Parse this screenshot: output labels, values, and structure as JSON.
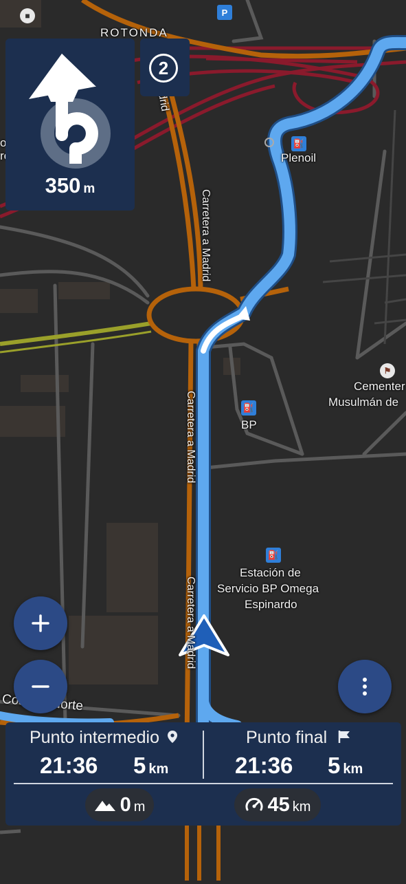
{
  "navigation": {
    "next_maneuver": {
      "distance_value": "350",
      "distance_unit": "m",
      "maneuver_icon": "roundabout-exit-icon"
    },
    "roundabout_exit_number": "2"
  },
  "map": {
    "place_labels": {
      "rotonda": "ROTONDA",
      "plenoil": "Plenoil",
      "bp": "BP",
      "cemetery_line1": "Cementer",
      "cemetery_line2": "Musulmán de",
      "station_line1": "Estación de",
      "station_line2": "Servicio BP Omega",
      "station_line3": "Espinardo",
      "partial_left_1": "o",
      "partial_left_2": "ro"
    },
    "road_labels": {
      "carretera_1": "Carretera a Madrid",
      "carretera_2": "Carretera a Madrid",
      "carretera_3": "Carretera a Madrid",
      "madrid_top": "Madrid",
      "costera_norte": "Costera Norte"
    },
    "colors": {
      "route": "#5ea8ef",
      "primary_road": "#b5620a",
      "motorway": "#8a1a2c",
      "secondary": "#9aa02a",
      "background": "#2a2a2a"
    }
  },
  "controls": {
    "zoom_in_icon": "plus-icon",
    "zoom_out_icon": "minus-icon",
    "menu_icon": "more-vertical-icon"
  },
  "summary": {
    "intermediate": {
      "label": "Punto intermedio",
      "time": "21:36",
      "distance_value": "5",
      "distance_unit": "km",
      "icon": "location-pin-icon"
    },
    "final": {
      "label": "Punto final",
      "time": "21:36",
      "distance_value": "5",
      "distance_unit": "km",
      "icon": "flag-icon"
    },
    "elevation": {
      "value": "0",
      "unit": "m",
      "icon": "mountain-icon"
    },
    "speed": {
      "value": "45",
      "unit": "km",
      "icon": "speedometer-icon"
    }
  }
}
